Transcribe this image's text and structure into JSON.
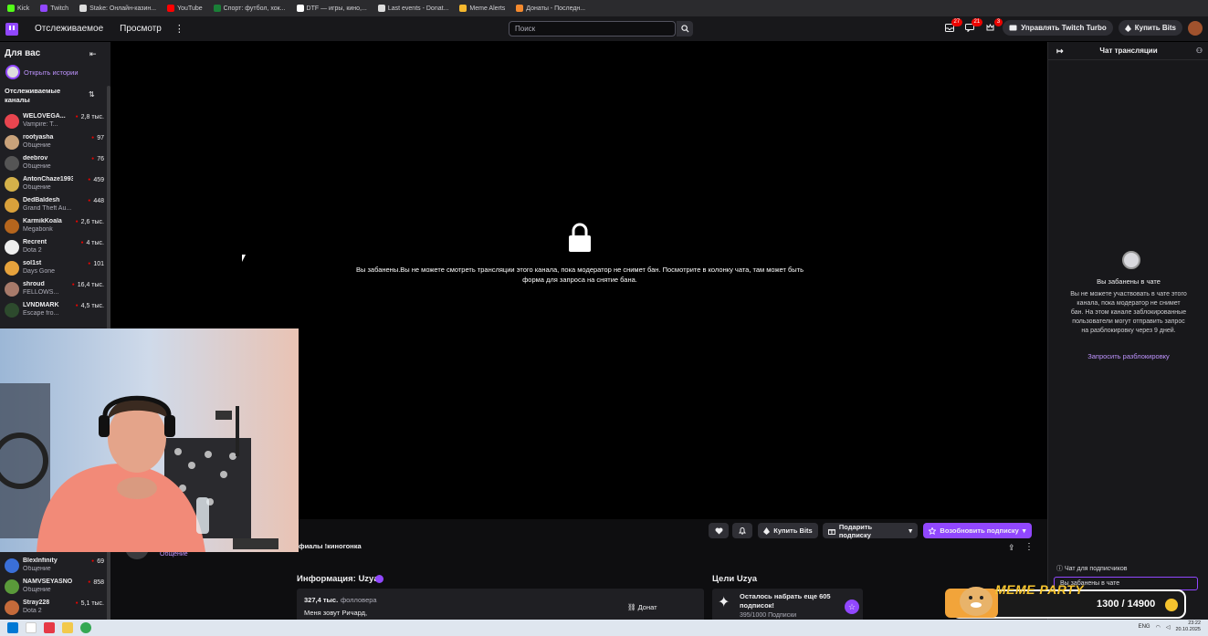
{
  "bookmarks": [
    {
      "label": "Kick",
      "color": "#53fc18"
    },
    {
      "label": "Twitch",
      "color": "#9147ff"
    },
    {
      "label": "Stake: Онлайн-казин...",
      "color": "#dddddd"
    },
    {
      "label": "YouTube",
      "color": "#ff0000"
    },
    {
      "label": "Спорт: футбол, хок...",
      "color": "#1a7f37"
    },
    {
      "label": "DTF — игры, кино,...",
      "color": "#ffffff"
    },
    {
      "label": "Last events - Donat...",
      "color": "#dddddd"
    },
    {
      "label": "Meme Alerts",
      "color": "#f5b82e"
    },
    {
      "label": "Донаты - Последн...",
      "color": "#f58a2e"
    }
  ],
  "topnav": {
    "following": "Отслеживаемое",
    "browse": "Просмотр",
    "more": "⋮",
    "search_placeholder": "Поиск",
    "badge_inbox": "27",
    "badge_whispers": "21",
    "badge_prime": "3",
    "turbo": "Управлять Twitch Turbo",
    "bits": "Купить Bits"
  },
  "sidebar": {
    "title": "Для вас",
    "stories": "Открыть истории",
    "followed_header": "Отслеживаемые каналы",
    "channels": [
      {
        "name": "WELOVEGA...",
        "game": "Vampire: T...",
        "viewers": "2,8 тыс.",
        "color": "#e8454f"
      },
      {
        "name": "rootyasha",
        "game": "Общение",
        "viewers": "97",
        "color": "#c9a27a"
      },
      {
        "name": "deebrov",
        "game": "Общение",
        "viewers": "76",
        "color": "#555555"
      },
      {
        "name": "AntonChaze1993",
        "game": "Общение",
        "viewers": "459",
        "color": "#d4b14a"
      },
      {
        "name": "DedBaldesh",
        "game": "Grand Theft Au...",
        "viewers": "448",
        "color": "#d9a13b"
      },
      {
        "name": "KarmikKoala",
        "game": "Megabonk",
        "viewers": "2,6 тыс.",
        "color": "#b5651d"
      },
      {
        "name": "Recrent",
        "game": "Dota 2",
        "viewers": "4 тыс.",
        "color": "#eeeeee"
      },
      {
        "name": "sol1st",
        "game": "Days Gone",
        "viewers": "101",
        "color": "#e6a23c"
      },
      {
        "name": "shroud",
        "game": "FELLOWS...",
        "viewers": "16,4 тыс.",
        "color": "#a77a6a"
      },
      {
        "name": "LVNDMARK",
        "game": "Escape fro...",
        "viewers": "4,5 тыс.",
        "color": "#2d4a2d"
      },
      {
        "name": "BlexInfinity",
        "game": "Общение",
        "viewers": "69",
        "color": "#3a6fd8"
      },
      {
        "name": "NAMVSEYASNO",
        "game": "Общение",
        "viewers": "858",
        "color": "#5a9a3a"
      },
      {
        "name": "Stray228",
        "game": "Dota 2",
        "viewers": "5,1 тыс.",
        "color": "#c46a3a"
      }
    ]
  },
  "player": {
    "ban_message": "Вы забанены.Вы не можете смотреть трансляции этого канала, пока модератор не снимет бан. Посмотрите в колонку чата, там может быть форма для запроса на снятие бана."
  },
  "stream": {
    "title_fragment": "фиалы !киногонка",
    "category": "Общение",
    "buy_bits": "Купить Bits",
    "gift_sub": "Подарить подписку",
    "resub": "Возобновить подписку",
    "info_title": "Информация: Uzya",
    "followers_count": "327,4 тыс.",
    "followers_label": "фолловера",
    "bio": "Меня зовут Ричард,",
    "donate": "Донат",
    "goals_title": "Цели Uzya",
    "goal_text": "Осталось набрать еще 605 подписок!",
    "goal_progress": "395/1000 Подписки"
  },
  "chat": {
    "header": "Чат трансляции",
    "banned_title": "Вы забанены в чате",
    "banned_desc": "Вы не можете участвовать в чате этого канала, пока модератор не снимет бан. На этом канале заблокированные пользователи могут отправить запрос на разблокировку через 9 дней.",
    "unban_link": "Запросить разблокировку",
    "subs_only": "Чат для подписчиков",
    "input_text": "Вы забанены в чате"
  },
  "overlay": {
    "title": "MEME PARTY",
    "progress": "1300 / 14900"
  },
  "taskbar": {
    "lang": "ENG",
    "time": "23:22",
    "date": "20.10.2025"
  }
}
